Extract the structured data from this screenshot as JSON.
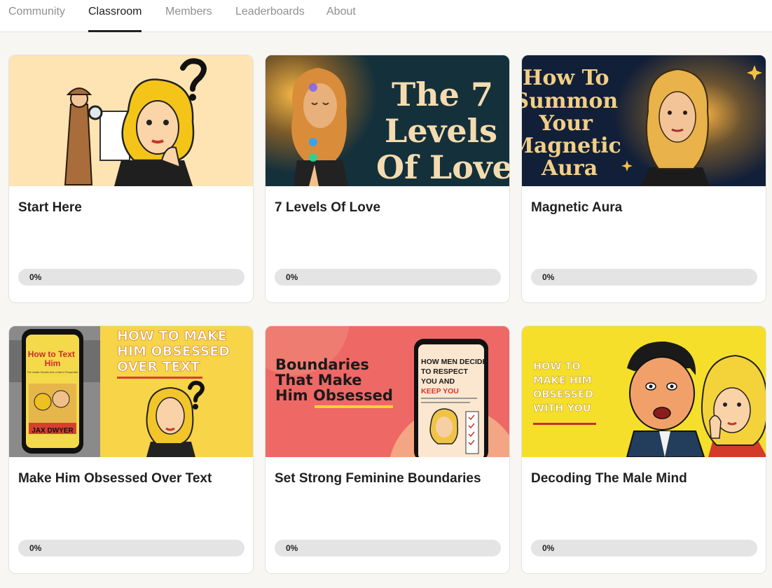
{
  "nav": {
    "tabs": [
      {
        "label": "Community",
        "active": false
      },
      {
        "label": "Classroom",
        "active": true
      },
      {
        "label": "Members",
        "active": false
      },
      {
        "label": "Leaderboards",
        "active": false
      },
      {
        "label": "About",
        "active": false
      }
    ]
  },
  "courses": [
    {
      "title": "Start Here",
      "progress_label": "0%",
      "progress": 0,
      "thumb": {
        "bg": "#fde4b2"
      }
    },
    {
      "title": "7 Levels Of Love",
      "progress_label": "0%",
      "progress": 0,
      "thumb": {
        "bg": "#14303b",
        "line1": "The 7",
        "line2": "Levels",
        "line3": "Of Love"
      }
    },
    {
      "title": "Magnetic Aura",
      "progress_label": "0%",
      "progress": 0,
      "thumb": {
        "bg": "#121f38",
        "line1": "How To",
        "line2": "Summon",
        "line3": "Your",
        "line4": "Magnetic",
        "line5": "Aura"
      }
    },
    {
      "title": "Make Him Obsessed Over Text",
      "progress_label": "0%",
      "progress": 0,
      "thumb": {
        "bg": "#f7d448",
        "line1": "HOW TO MAKE",
        "line2": "HIM OBSESSED",
        "line3": "OVER TEXT",
        "phone_title1": "How to Text",
        "phone_title2": "Him",
        "phone_sub": "The Insider Secrets from a Man's Perspective",
        "author": "JAX DWYER"
      }
    },
    {
      "title": "Set Strong Feminine Boundaries",
      "progress_label": "0%",
      "progress": 0,
      "thumb": {
        "bg": "#ee6865",
        "line1": "Boundaries",
        "line2": "That Make",
        "line3": "Him Obsessed",
        "phone_line1": "HOW MEN DECIDE",
        "phone_line2": "TO RESPECT",
        "phone_line3": "YOU AND",
        "phone_line4": "KEEP YOU"
      }
    },
    {
      "title": "Decoding The Male Mind",
      "progress_label": "0%",
      "progress": 0,
      "thumb": {
        "bg": "#f5df2a",
        "line1": "HOW TO",
        "line2": "MAKE HIM",
        "line3": "OBSESSED",
        "line4": "WITH YOU"
      }
    }
  ],
  "colors": {
    "accent": "#f0c23a",
    "progress_track": "#e4e4e4",
    "active_tab": "#202124",
    "inactive_tab": "#909090"
  }
}
